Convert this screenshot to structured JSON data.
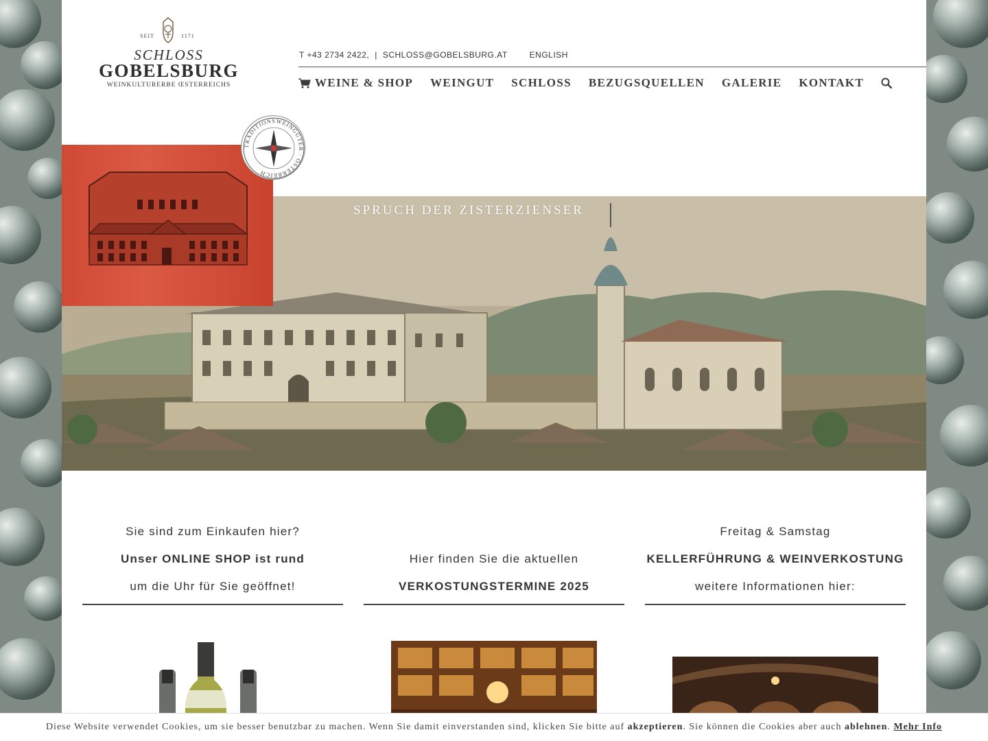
{
  "brand": {
    "seit": "SEIT",
    "year": "1171",
    "schloss": "SCHLOSS",
    "name": "GOBELSBURG",
    "tagline": "WEINKULTURERBE ŒSTERREICHS"
  },
  "topbar": {
    "phone": "T +43 2734 2422,",
    "separator": "|",
    "email": "SCHLOSS@GOBELSBURG.AT",
    "language": "ENGLISH"
  },
  "nav": {
    "items": [
      "WEINE & SHOP",
      "WEINGUT",
      "SCHLOSS",
      "BEZUGSQUELLEN",
      "GALERIE",
      "KONTAKT"
    ],
    "cart_icon": "shopping-cart-icon",
    "search_icon": "search-icon"
  },
  "hero": {
    "caption": "SPRUCH DER ZISTERZIENSER",
    "seal_text": "TRADITIONSWEINGÜTER · ÖSTERREICH"
  },
  "columns": [
    {
      "lines": [
        "Sie sind zum Einkaufen hier?",
        "Unser ONLINE SHOP ist rund",
        "um die Uhr für Sie geöffnet!"
      ]
    },
    {
      "lines": [
        "Hier finden Sie die aktuellen",
        "VERKOSTUNGSTERMINE 2025"
      ]
    },
    {
      "lines": [
        "Freitag & Samstag",
        "KELLERFÜHRUNG & WEINVERKOSTUNG",
        "weitere Informationen hier:"
      ]
    }
  ],
  "cookie": {
    "text_before": "Diese Website verwendet Cookies, um sie besser benutzbar zu machen. Wenn Sie damit einverstanden sind, klicken Sie bitte auf ",
    "accept": "akzeptieren",
    "text_middle": ". Sie können die Cookies aber auch ",
    "decline": "ablehnen",
    "text_after": ". ",
    "more": "Mehr Info"
  },
  "colors": {
    "accent_red": "#d3503b",
    "text": "#333333",
    "background_side": "#7f8a85"
  }
}
